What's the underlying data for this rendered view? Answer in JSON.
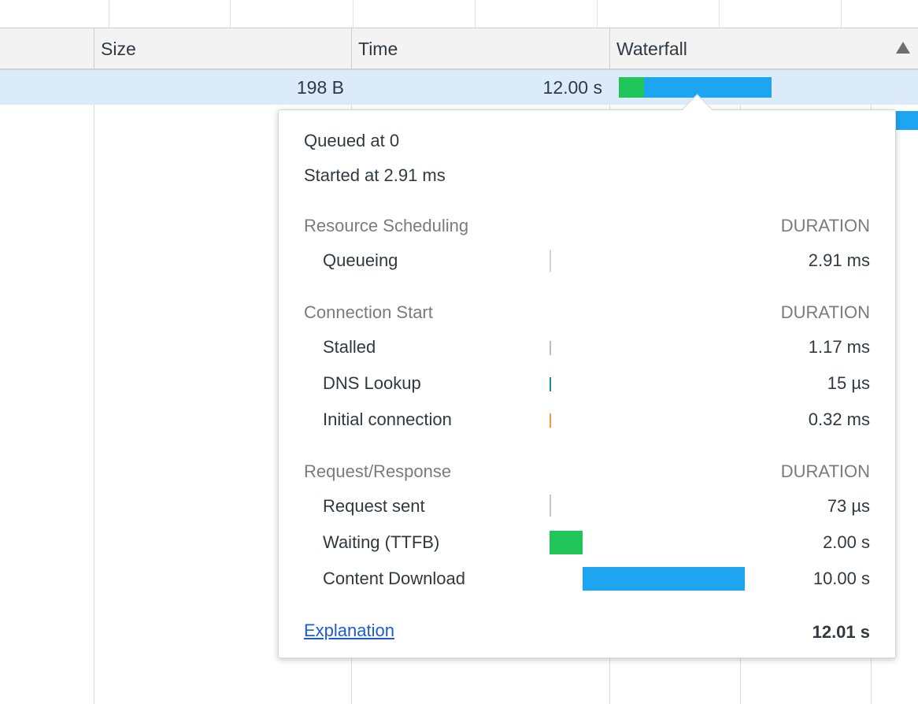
{
  "colors": {
    "waiting": "#21c65a",
    "download": "#1ea5f1",
    "dns": "#13918a",
    "connect": "#f39c3a",
    "stalled": "#bdbdbd",
    "selected_row": "#dcebfa"
  },
  "header": {
    "size": "Size",
    "time": "Time",
    "waterfall": "Waterfall",
    "sort_icon": "sort-ascending-icon"
  },
  "selected_row": {
    "size": "198 B",
    "time": "12.00 s"
  },
  "popup": {
    "queued": "Queued at 0",
    "started": "Started at 2.91 ms",
    "sections": [
      {
        "title": "Resource Scheduling",
        "duration_label": "DURATION",
        "rows": [
          {
            "label": "Queueing",
            "value": "2.91 ms"
          }
        ]
      },
      {
        "title": "Connection Start",
        "duration_label": "DURATION",
        "rows": [
          {
            "label": "Stalled",
            "value": "1.17 ms"
          },
          {
            "label": "DNS Lookup",
            "value": "15 µs"
          },
          {
            "label": "Initial connection",
            "value": "0.32 ms"
          }
        ]
      },
      {
        "title": "Request/Response",
        "duration_label": "DURATION",
        "rows": [
          {
            "label": "Request sent",
            "value": "73 µs"
          },
          {
            "label": "Waiting (TTFB)",
            "value": "2.00 s"
          },
          {
            "label": "Content Download",
            "value": "10.00 s"
          }
        ]
      }
    ],
    "explanation_link": "Explanation",
    "total": "12.01 s"
  }
}
